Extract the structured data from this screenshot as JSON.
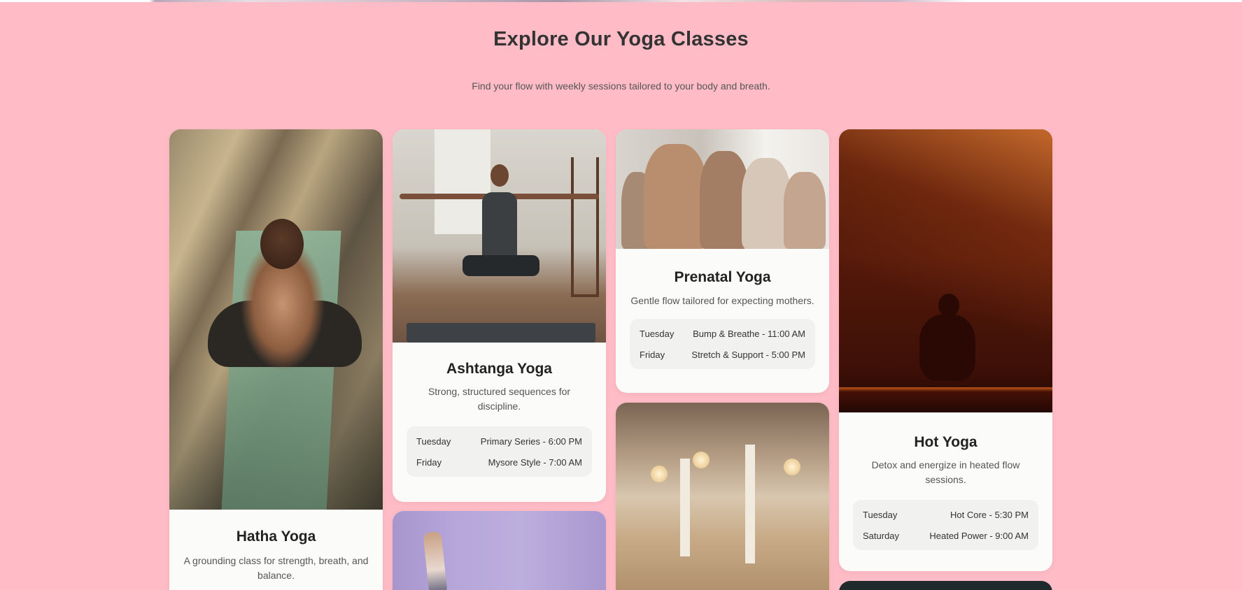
{
  "page": {
    "title": "Explore Our Yoga Classes",
    "subtitle": "Find your flow with weekly sessions tailored to your body and breath."
  },
  "classes": [
    {
      "name": "Hatha Yoga",
      "description": "A grounding class for strength, breath, and balance.",
      "schedule": []
    },
    {
      "name": "Ashtanga Yoga",
      "description": "Strong, structured sequences for discipline.",
      "schedule": [
        {
          "day": "Tuesday",
          "session": "Primary Series - 6:00 PM"
        },
        {
          "day": "Friday",
          "session": "Mysore Style - 7:00 AM"
        }
      ]
    },
    {
      "name": "Prenatal Yoga",
      "description": "Gentle flow tailored for expecting mothers.",
      "schedule": [
        {
          "day": "Tuesday",
          "session": "Bump & Breathe - 11:00 AM"
        },
        {
          "day": "Friday",
          "session": "Stretch & Support - 5:00 PM"
        }
      ]
    },
    {
      "name": "Hot Yoga",
      "description": "Detox and energize in heated flow sessions.",
      "schedule": [
        {
          "day": "Tuesday",
          "session": "Hot Core - 5:30 PM"
        },
        {
          "day": "Saturday",
          "session": "Heated Power - 9:00 AM"
        }
      ]
    }
  ],
  "images": {
    "hatha": "woman-seated-on-mat-image",
    "ashtanga": "man-warrior-pose-image",
    "prenatal": "group-seated-meditation-image",
    "hot": "silhouette-meditation-red-light-image",
    "studio": "studio-group-class-image",
    "lavender": "legs-against-lavender-wall-image"
  },
  "colors": {
    "background": "#ffbcc6",
    "card": "#fbfbfa",
    "schedule_bg": "#f1f1f0"
  }
}
